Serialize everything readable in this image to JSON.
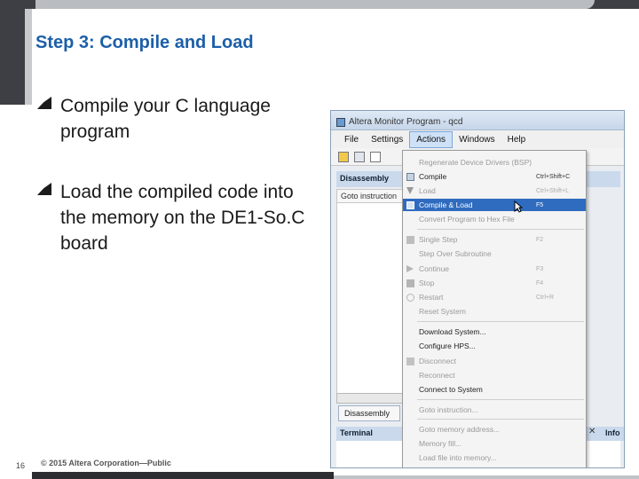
{
  "slide": {
    "title": "Step 3: Compile and Load",
    "bullets": [
      "Compile your C language program",
      "Load the compiled code into the memory on the DE1-So.C board"
    ],
    "page_number": "16",
    "footer": "© 2015 Altera Corporation—Public"
  },
  "window": {
    "title": "Altera Monitor Program - qcd",
    "menu": [
      "File",
      "Settings",
      "Actions",
      "Windows",
      "Help"
    ],
    "active_menu": "Actions",
    "panes": {
      "disassembly": "Disassembly",
      "goto": "Goto instruction",
      "tab": "Disassembly",
      "terminal": "Terminal",
      "info": "Info"
    },
    "actions_menu": [
      {
        "label": "Regenerate Device Drivers (BSP)",
        "shortcut": "",
        "state": "disabled"
      },
      {
        "label": "Compile",
        "shortcut": "Ctrl+Shift+C",
        "state": "enabled"
      },
      {
        "label": "Load",
        "shortcut": "Ctrl+Shift+L",
        "state": "disabled"
      },
      {
        "label": "Compile & Load",
        "shortcut": "F5",
        "state": "selected"
      },
      {
        "label": "Convert Program to Hex File",
        "shortcut": "",
        "state": "disabled"
      },
      {
        "label": "Single Step",
        "shortcut": "F2",
        "state": "disabled"
      },
      {
        "label": "Step Over Subroutine",
        "shortcut": "",
        "state": "disabled"
      },
      {
        "label": "Continue",
        "shortcut": "F3",
        "state": "disabled"
      },
      {
        "label": "Stop",
        "shortcut": "F4",
        "state": "disabled"
      },
      {
        "label": "Restart",
        "shortcut": "Ctrl+R",
        "state": "disabled"
      },
      {
        "label": "Reset System",
        "shortcut": "",
        "state": "disabled"
      },
      {
        "label": "Download System...",
        "shortcut": "",
        "state": "enabled"
      },
      {
        "label": "Configure HPS...",
        "shortcut": "",
        "state": "enabled"
      },
      {
        "label": "Disconnect",
        "shortcut": "",
        "state": "disabled"
      },
      {
        "label": "Reconnect",
        "shortcut": "",
        "state": "disabled"
      },
      {
        "label": "Connect to System",
        "shortcut": "",
        "state": "enabled"
      },
      {
        "label": "Goto instruction...",
        "shortcut": "",
        "state": "disabled"
      },
      {
        "label": "Goto memory address...",
        "shortcut": "",
        "state": "disabled"
      },
      {
        "label": "Memory fill...",
        "shortcut": "",
        "state": "disabled"
      },
      {
        "label": "Load file into memory...",
        "shortcut": "",
        "state": "disabled"
      }
    ]
  },
  "colors": {
    "title": "#1c5fa8",
    "selected": "#2f6bbf"
  }
}
